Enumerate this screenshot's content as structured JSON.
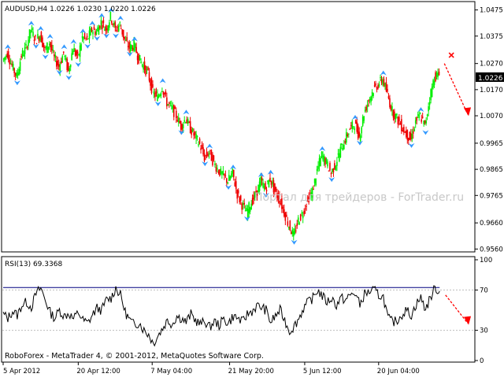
{
  "main_header": "AUDUSD,H4  1.0226 1.0230 1.0220 1.0226",
  "watermark": "Портал для трейдеров - ForTrader.ru",
  "rsi_header": "RSI(13) 69.3368",
  "footer": "RoboForex - MetaTrader 4, © 2001-2012, MetaQuotes Software Corp.",
  "current_price_label": "1.0226",
  "colors": {
    "background": "#ffffff",
    "bull_candle": "#00ee00",
    "bear_candle": "#ee0000",
    "fractal_marker": "#3399ff",
    "rsi_line": "#000000",
    "rsi_level_line": "#000080",
    "forecast_arrow": "#ff0000",
    "grid_text": "#000000"
  },
  "chart_data": [
    {
      "type": "candlestick",
      "symbol": "AUDUSD",
      "timeframe": "H4",
      "ohlc_current": {
        "open": 1.0226,
        "high": 1.023,
        "low": 1.022,
        "close": 1.0226
      },
      "y_ticks": [
        "1.0475",
        "1.0375",
        "1.0270",
        "1.0170",
        "1.0070",
        "0.9965",
        "0.9865",
        "0.9765",
        "0.9660",
        "0.9560"
      ],
      "ylim": [
        0.9555,
        1.0495
      ],
      "x_ticks": [
        "5 Apr 2012",
        "20 Apr 12:00",
        "7 May 04:00",
        "21 May 20:00",
        "5 Jun 12:00",
        "20 Jun 04:00"
      ],
      "price_path": [
        [
          0,
          1.028
        ],
        [
          4,
          1.031
        ],
        [
          8,
          1.026
        ],
        [
          12,
          1.022
        ],
        [
          16,
          1.03
        ],
        [
          20,
          1.033
        ],
        [
          24,
          1.04
        ],
        [
          28,
          1.036
        ],
        [
          32,
          1.038
        ],
        [
          36,
          1.032
        ],
        [
          40,
          1.035
        ],
        [
          44,
          1.029
        ],
        [
          48,
          1.026
        ],
        [
          52,
          1.031
        ],
        [
          56,
          1.024
        ],
        [
          60,
          1.033
        ],
        [
          64,
          1.029
        ],
        [
          68,
          1.037
        ],
        [
          72,
          1.036
        ],
        [
          76,
          1.04
        ],
        [
          80,
          1.039
        ],
        [
          84,
          1.043
        ],
        [
          88,
          1.04
        ],
        [
          92,
          1.045
        ],
        [
          96,
          1.04
        ],
        [
          100,
          1.042
        ],
        [
          104,
          1.036
        ],
        [
          108,
          1.033
        ],
        [
          112,
          1.034
        ],
        [
          116,
          1.029
        ],
        [
          120,
          1.026
        ],
        [
          124,
          1.023
        ],
        [
          128,
          1.016
        ],
        [
          132,
          1.014
        ],
        [
          136,
          1.018
        ],
        [
          140,
          1.012
        ],
        [
          144,
          1.01
        ],
        [
          148,
          1.007
        ],
        [
          152,
          1.003
        ],
        [
          156,
          1.006
        ],
        [
          160,
          1.002
        ],
        [
          164,
          0.999
        ],
        [
          168,
          0.996
        ],
        [
          172,
          0.991
        ],
        [
          176,
          0.993
        ],
        [
          180,
          0.989
        ],
        [
          184,
          0.986
        ],
        [
          188,
          0.984
        ],
        [
          192,
          0.982
        ],
        [
          196,
          0.985
        ],
        [
          200,
          0.977
        ],
        [
          204,
          0.973
        ],
        [
          208,
          0.97
        ],
        [
          212,
          0.974
        ],
        [
          216,
          0.977
        ],
        [
          220,
          0.982
        ],
        [
          224,
          0.979
        ],
        [
          228,
          0.983
        ],
        [
          232,
          0.978
        ],
        [
          236,
          0.975
        ],
        [
          240,
          0.97
        ],
        [
          244,
          0.965
        ],
        [
          248,
          0.961
        ],
        [
          252,
          0.967
        ],
        [
          256,
          0.97
        ],
        [
          260,
          0.975
        ],
        [
          264,
          0.978
        ],
        [
          268,
          0.986
        ],
        [
          272,
          0.992
        ],
        [
          276,
          0.989
        ],
        [
          280,
          0.985
        ],
        [
          284,
          0.989
        ],
        [
          288,
          0.994
        ],
        [
          292,
          0.998
        ],
        [
          296,
          1.002
        ],
        [
          300,
          1.004
        ],
        [
          304,
          0.999
        ],
        [
          308,
          1.008
        ],
        [
          312,
          1.013
        ],
        [
          316,
          1.017
        ],
        [
          320,
          1.019
        ],
        [
          324,
          1.021
        ],
        [
          328,
          1.015
        ],
        [
          332,
          1.009
        ],
        [
          336,
          1.006
        ],
        [
          340,
          1.003
        ],
        [
          344,
          1.0
        ],
        [
          348,
          0.998
        ],
        [
          352,
          1.005
        ],
        [
          356,
          1.007
        ],
        [
          360,
          1.003
        ],
        [
          364,
          1.014
        ],
        [
          368,
          1.022
        ],
        [
          372,
          1.0226
        ]
      ],
      "forecast_arrow": {
        "from": [
          376,
          1.027
        ],
        "to": [
          396,
          1.0075
        ]
      },
      "cross_marker": [
        382,
        1.0302
      ]
    },
    {
      "type": "line",
      "name": "RSI(13)",
      "current_value": 69.3368,
      "ylim": [
        0,
        100
      ],
      "y_ticks": [
        100,
        70,
        30,
        0
      ],
      "levels": [
        70,
        30
      ],
      "values": [
        [
          0,
          46
        ],
        [
          4,
          42
        ],
        [
          8,
          49
        ],
        [
          12,
          45
        ],
        [
          16,
          55
        ],
        [
          20,
          58
        ],
        [
          24,
          53
        ],
        [
          28,
          66
        ],
        [
          32,
          72
        ],
        [
          36,
          60
        ],
        [
          40,
          48
        ],
        [
          44,
          42
        ],
        [
          48,
          50
        ],
        [
          52,
          44
        ],
        [
          56,
          47
        ],
        [
          60,
          41
        ],
        [
          64,
          48
        ],
        [
          68,
          40
        ],
        [
          72,
          37
        ],
        [
          76,
          45
        ],
        [
          80,
          52
        ],
        [
          84,
          50
        ],
        [
          88,
          60
        ],
        [
          92,
          62
        ],
        [
          96,
          72
        ],
        [
          100,
          65
        ],
        [
          104,
          48
        ],
        [
          108,
          40
        ],
        [
          112,
          35
        ],
        [
          116,
          38
        ],
        [
          120,
          30
        ],
        [
          124,
          26
        ],
        [
          128,
          17
        ],
        [
          132,
          25
        ],
        [
          136,
          32
        ],
        [
          140,
          40
        ],
        [
          144,
          36
        ],
        [
          148,
          44
        ],
        [
          152,
          42
        ],
        [
          156,
          38
        ],
        [
          160,
          46
        ],
        [
          164,
          40
        ],
        [
          168,
          36
        ],
        [
          172,
          39
        ],
        [
          176,
          33
        ],
        [
          180,
          39
        ],
        [
          184,
          35
        ],
        [
          188,
          41
        ],
        [
          192,
          37
        ],
        [
          196,
          44
        ],
        [
          200,
          42
        ],
        [
          204,
          38
        ],
        [
          208,
          46
        ],
        [
          212,
          49
        ],
        [
          216,
          54
        ],
        [
          220,
          53
        ],
        [
          224,
          50
        ],
        [
          228,
          38
        ],
        [
          232,
          44
        ],
        [
          236,
          50
        ],
        [
          240,
          40
        ],
        [
          244,
          29
        ],
        [
          248,
          34
        ],
        [
          252,
          42
        ],
        [
          256,
          52
        ],
        [
          260,
          58
        ],
        [
          264,
          62
        ],
        [
          268,
          70
        ],
        [
          272,
          64
        ],
        [
          276,
          58
        ],
        [
          280,
          62
        ],
        [
          284,
          55
        ],
        [
          288,
          62
        ],
        [
          292,
          60
        ],
        [
          296,
          65
        ],
        [
          300,
          67
        ],
        [
          304,
          55
        ],
        [
          308,
          66
        ],
        [
          312,
          68
        ],
        [
          316,
          70
        ],
        [
          320,
          65
        ],
        [
          324,
          63
        ],
        [
          328,
          42
        ],
        [
          332,
          38
        ],
        [
          336,
          40
        ],
        [
          340,
          46
        ],
        [
          344,
          50
        ],
        [
          348,
          45
        ],
        [
          352,
          56
        ],
        [
          356,
          62
        ],
        [
          360,
          51
        ],
        [
          364,
          62
        ],
        [
          368,
          72
        ],
        [
          372,
          69
        ]
      ],
      "forecast_arrow": {
        "from": [
          377,
          65
        ],
        "to": [
          396,
          37
        ]
      }
    }
  ]
}
